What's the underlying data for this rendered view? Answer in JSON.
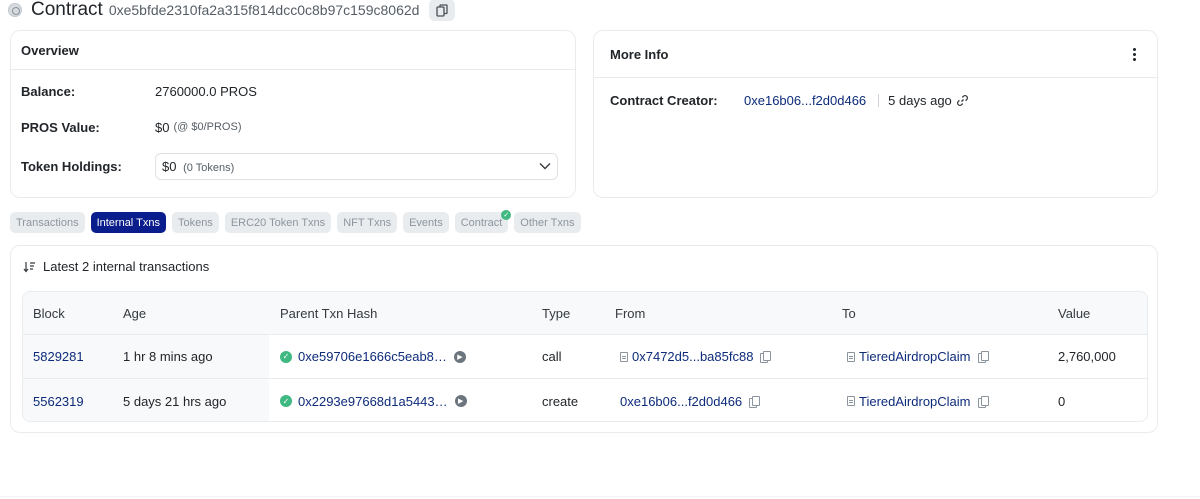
{
  "header": {
    "title": "Contract",
    "address": "0xe5bfde2310fa2a315f814dcc0c8b97c159c8062d",
    "icons": {
      "logo": "contract-logo-icon",
      "copy": "copy-icon"
    }
  },
  "overview": {
    "title": "Overview",
    "balance_label": "Balance:",
    "balance_value": "2760000.0 PROS",
    "pros_value_label": "PROS Value:",
    "pros_value": "$0",
    "pros_value_rate": "(@ $0/PROS)",
    "token_holdings_label": "Token Holdings:",
    "token_holdings_value": "$0",
    "token_holdings_count": "(0 Tokens)"
  },
  "more_info": {
    "title": "More Info",
    "creator_label": "Contract Creator:",
    "creator_address": "0xe16b06...f2d0d466",
    "creator_age": "5 days ago"
  },
  "tabs": [
    {
      "label": "Transactions",
      "active": false
    },
    {
      "label": "Internal Txns",
      "active": true
    },
    {
      "label": "Tokens",
      "active": false
    },
    {
      "label": "ERC20 Token Txns",
      "active": false
    },
    {
      "label": "NFT Txns",
      "active": false
    },
    {
      "label": "Events",
      "active": false
    },
    {
      "label": "Contract",
      "active": false,
      "verified": true
    },
    {
      "label": "Other Txns",
      "active": false
    }
  ],
  "transactions": {
    "summary": "Latest 2 internal transactions",
    "columns": [
      "Block",
      "Age",
      "Parent Txn Hash",
      "Type",
      "From",
      "To",
      "Value"
    ],
    "rows": [
      {
        "block": "5829281",
        "age": "1 hr 8 mins ago",
        "parent_hash": "0xe59706e1666c5eab8…",
        "type": "call",
        "from": "0x7472d5...ba85fc88",
        "to": "TieredAirdropClaim",
        "value": "2,760,000"
      },
      {
        "block": "5562319",
        "age": "5 days 21 hrs ago",
        "parent_hash": "0x2293e97668d1a5443…",
        "type": "create",
        "from": "0xe16b06...f2d0d466",
        "to": "TieredAirdropClaim",
        "value": "0"
      }
    ]
  },
  "colors": {
    "accent": "#0a1d8c",
    "link": "#0d2b7a",
    "success": "#40b882"
  }
}
